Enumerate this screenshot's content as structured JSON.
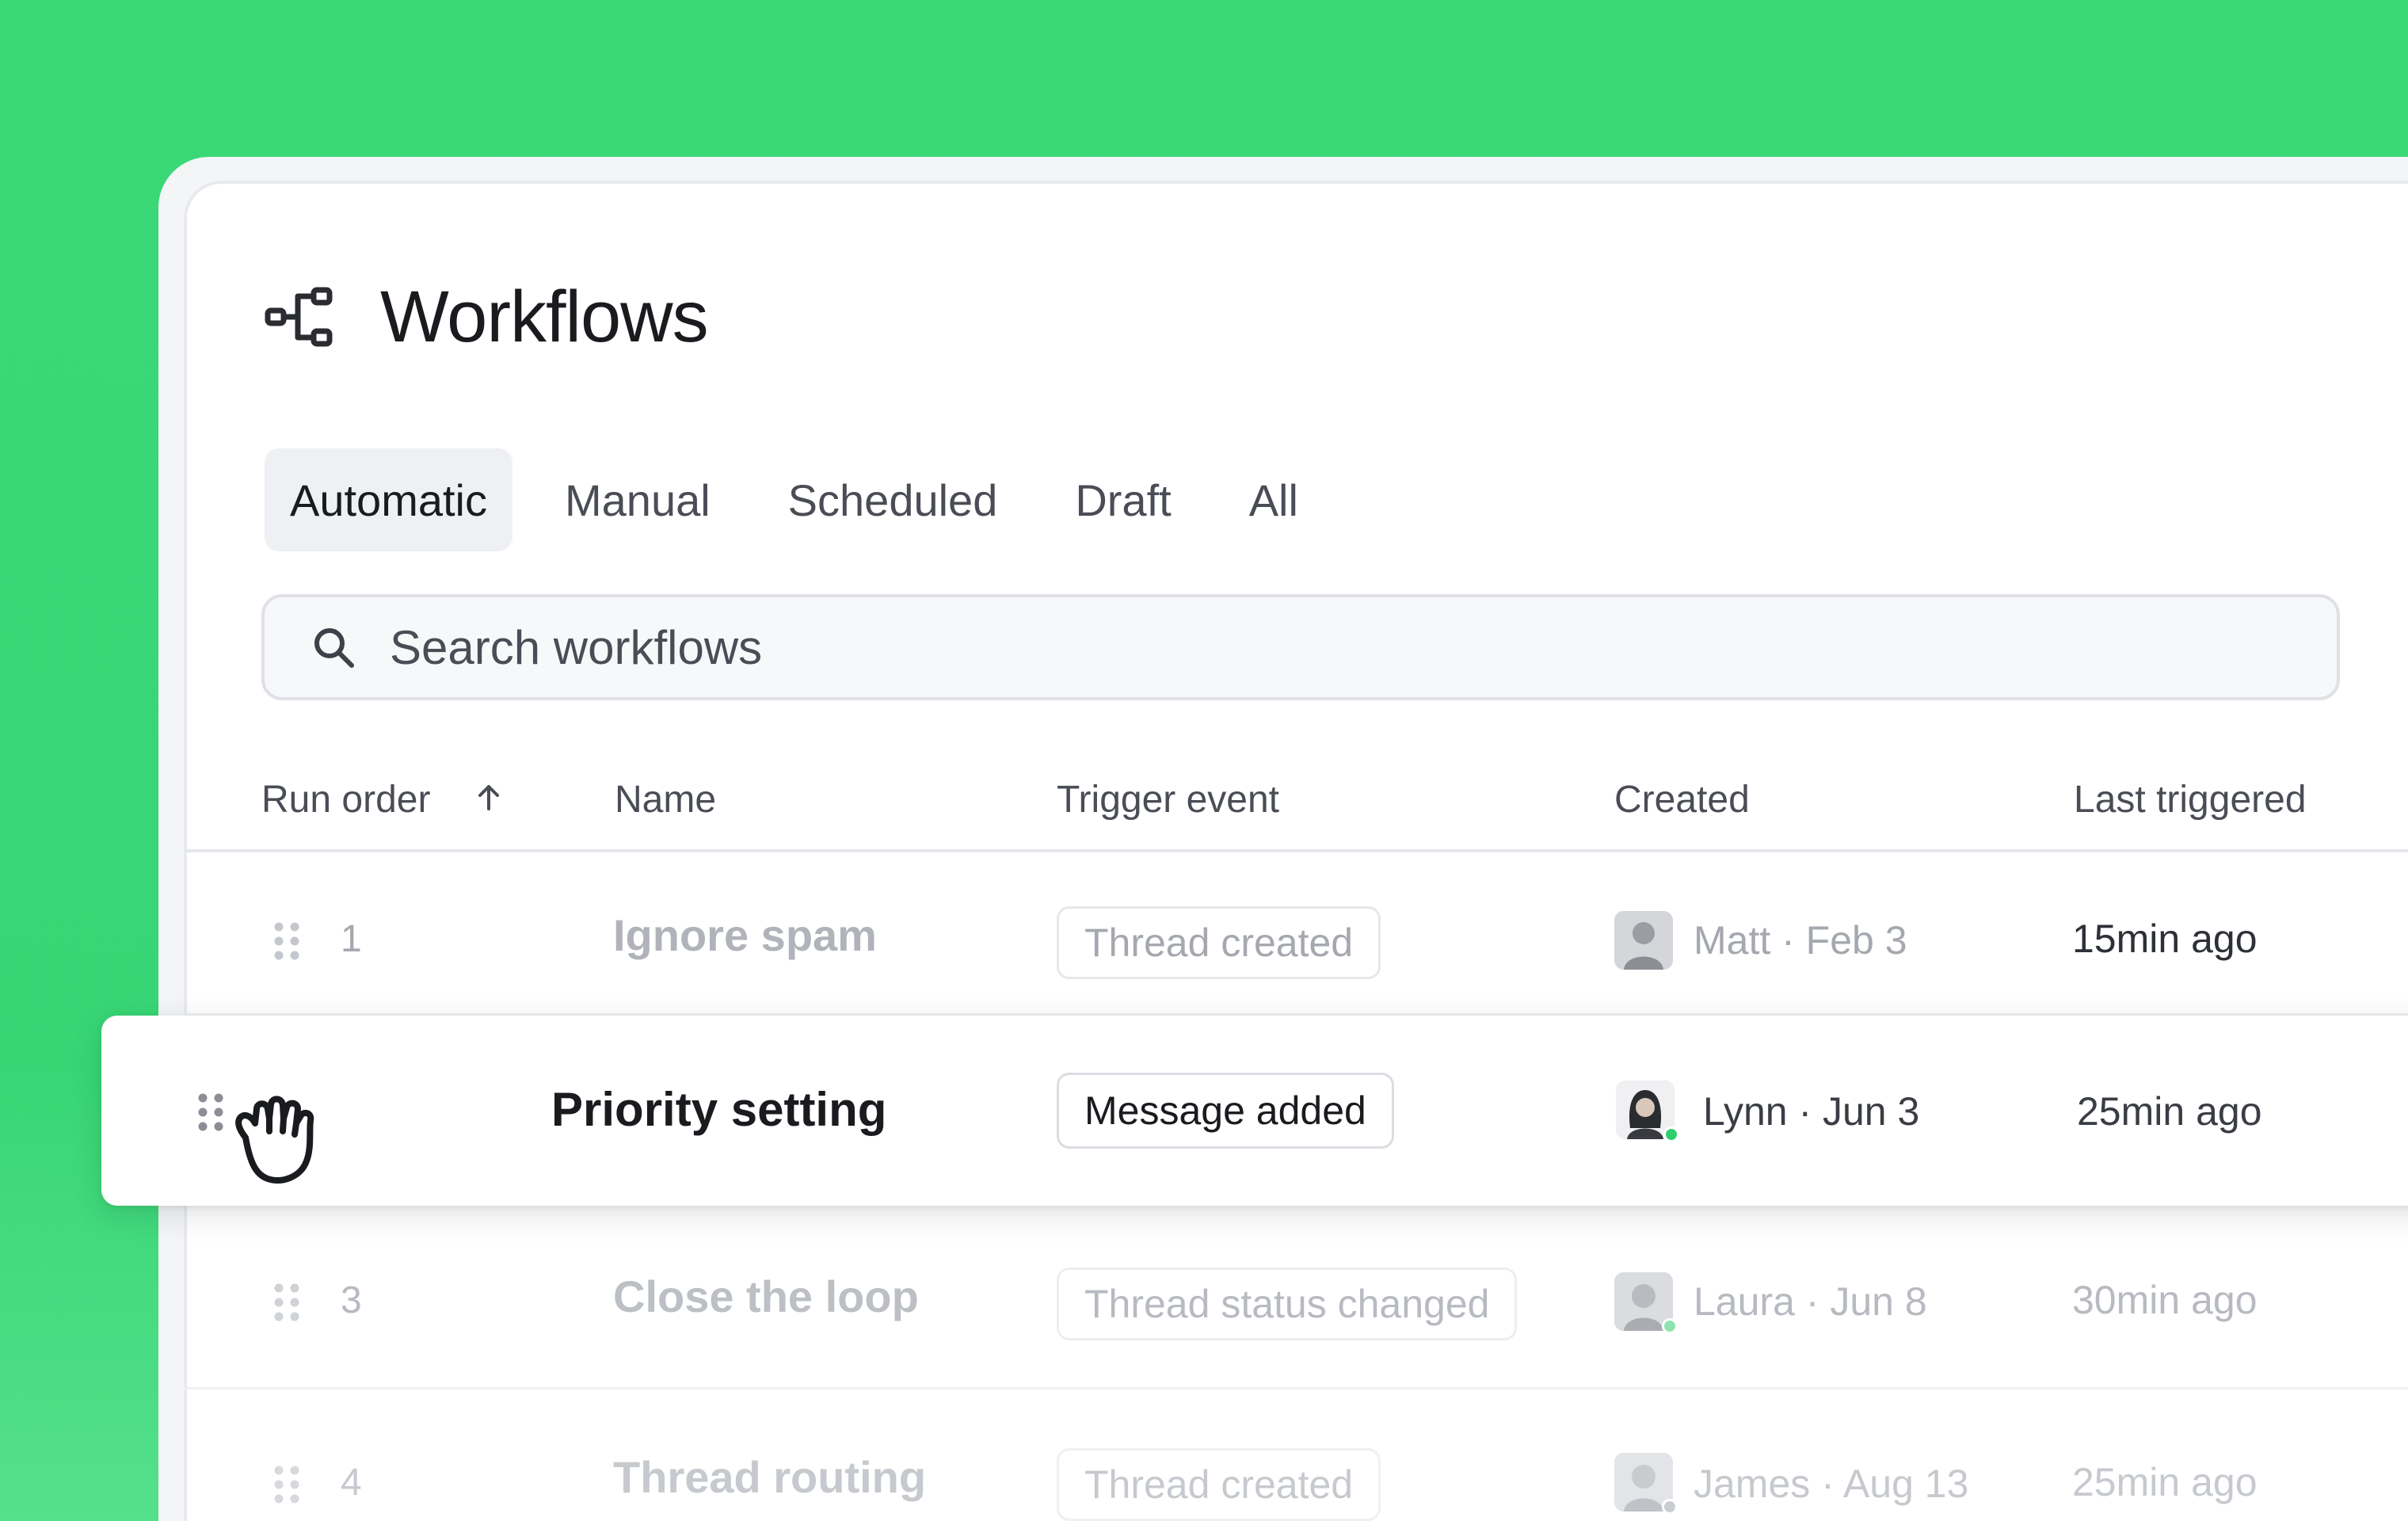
{
  "page": {
    "title": "Workflows",
    "title_icon": "workflow-icon"
  },
  "tabs": [
    {
      "label": "Automatic",
      "active": true
    },
    {
      "label": "Manual",
      "active": false
    },
    {
      "label": "Scheduled",
      "active": false
    },
    {
      "label": "Draft",
      "active": false
    },
    {
      "label": "All",
      "active": false
    }
  ],
  "search": {
    "placeholder": "Search workflows",
    "icon": "search-icon"
  },
  "table": {
    "columns": {
      "run_order": "Run order",
      "name": "Name",
      "trigger": "Trigger event",
      "created": "Created",
      "last_triggered": "Last triggered"
    },
    "sort": {
      "column": "run_order",
      "direction": "ascending",
      "icon": "arrow-up-icon"
    },
    "rows": [
      {
        "order": "1",
        "name": "Ignore spam",
        "trigger": "Thread created",
        "created": "Matt · Feb 3",
        "last": "15min ago",
        "online": false
      },
      {
        "order": "",
        "name": "Priority setting",
        "trigger": "Message added",
        "created": "Lynn · Jun 3",
        "last": "25min ago",
        "online": true,
        "dragging": true
      },
      {
        "order": "3",
        "name": "Close the loop",
        "trigger": "Thread status changed",
        "created": "Laura · Jun 8",
        "last": "30min ago",
        "online": true
      },
      {
        "order": "4",
        "name": "Thread routing",
        "trigger": "Thread created",
        "created": "James · Aug 13",
        "last": "25min ago",
        "online": true
      }
    ]
  },
  "colors": {
    "background": "#3bd877",
    "online": "#2fce6c",
    "text": "#1a1b1f"
  },
  "cursor": "grab-hand-icon"
}
